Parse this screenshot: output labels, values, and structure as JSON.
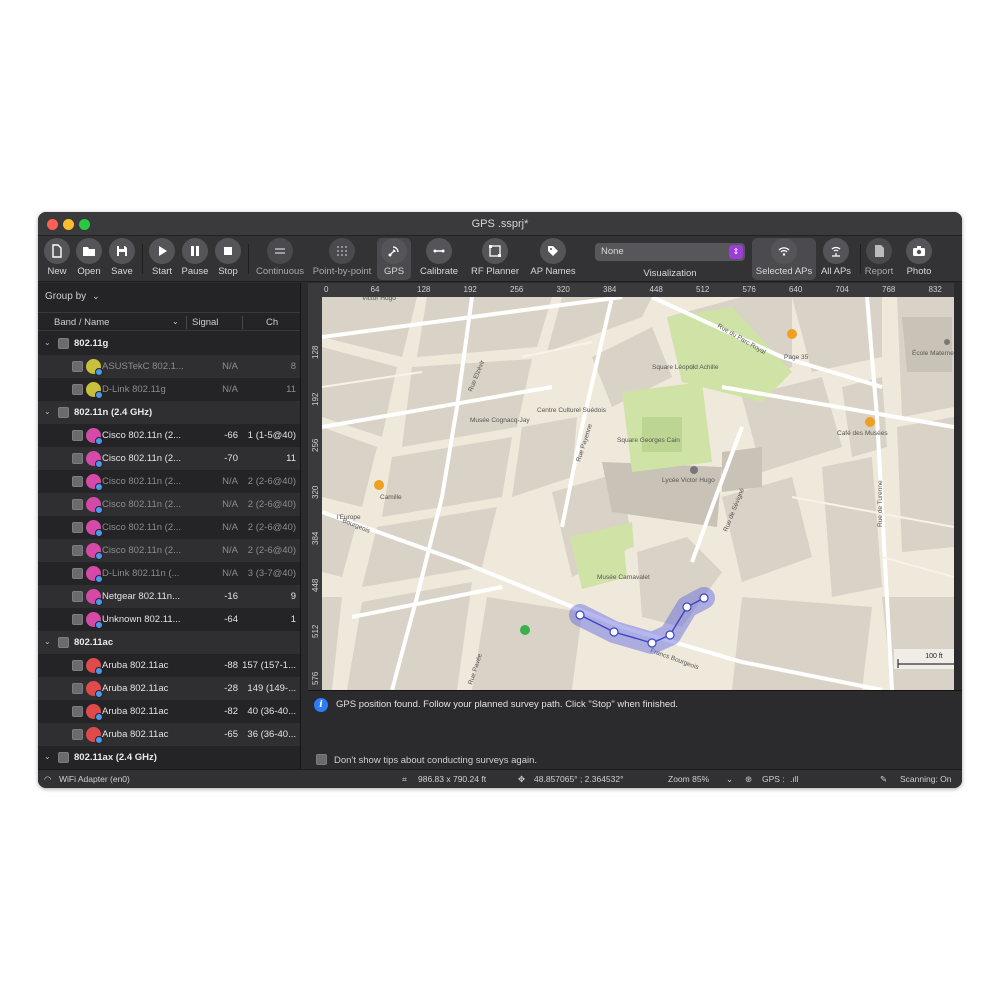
{
  "window": {
    "title": "GPS .ssprj*"
  },
  "toolbar": {
    "new": "New",
    "open": "Open",
    "save": "Save",
    "start": "Start",
    "pause": "Pause",
    "stop": "Stop",
    "continuous": "Continuous",
    "point_by_point": "Point-by-point",
    "gps": "GPS",
    "calibrate": "Calibrate",
    "rf_planner": "RF Planner",
    "ap_names": "AP Names",
    "visualization_value": "None",
    "visualization_label": "Visualization",
    "selected_aps": "Selected APs",
    "all_aps": "All APs",
    "report": "Report",
    "photo": "Photo"
  },
  "sidebar": {
    "group_by": "Group by",
    "columns": {
      "band_name": "Band / Name",
      "signal": "Signal",
      "ch": "Ch"
    },
    "rows": [
      {
        "type": "group",
        "band": "802.11g"
      },
      {
        "type": "ap",
        "name": "ASUSTekC 802.1...",
        "signal": "N/A",
        "ch": "8",
        "muted": true,
        "color": "#c8c03a"
      },
      {
        "type": "ap",
        "name": "D-Link 802.11g",
        "signal": "N/A",
        "ch": "11",
        "muted": true,
        "color": "#c8c03a"
      },
      {
        "type": "group",
        "band": "802.11n (2.4 GHz)"
      },
      {
        "type": "ap",
        "name": "Cisco 802.11n (2...",
        "signal": "-66",
        "ch": "1 (1-5@40)",
        "muted": false,
        "color": "#d54aa8"
      },
      {
        "type": "ap",
        "name": "Cisco 802.11n (2...",
        "signal": "-70",
        "ch": "11",
        "muted": false,
        "color": "#d54aa8"
      },
      {
        "type": "ap",
        "name": "Cisco 802.11n (2...",
        "signal": "N/A",
        "ch": "2 (2-6@40)",
        "muted": true,
        "color": "#d54aa8"
      },
      {
        "type": "ap",
        "name": "Cisco 802.11n (2...",
        "signal": "N/A",
        "ch": "2 (2-6@40)",
        "muted": true,
        "color": "#d54aa8"
      },
      {
        "type": "ap",
        "name": "Cisco 802.11n (2...",
        "signal": "N/A",
        "ch": "2 (2-6@40)",
        "muted": true,
        "color": "#d54aa8"
      },
      {
        "type": "ap",
        "name": "Cisco 802.11n (2...",
        "signal": "N/A",
        "ch": "2 (2-6@40)",
        "muted": true,
        "color": "#d54aa8"
      },
      {
        "type": "ap",
        "name": "D-Link 802.11n (...",
        "signal": "N/A",
        "ch": "3 (3-7@40)",
        "muted": true,
        "color": "#d54aa8"
      },
      {
        "type": "ap",
        "name": "Netgear 802.11n...",
        "signal": "-16",
        "ch": "9",
        "muted": false,
        "color": "#d54aa8"
      },
      {
        "type": "ap",
        "name": "Unknown 802.11...",
        "signal": "-64",
        "ch": "1",
        "muted": false,
        "color": "#d54aa8"
      },
      {
        "type": "group",
        "band": "802.11ac"
      },
      {
        "type": "ap",
        "name": "Aruba 802.11ac",
        "signal": "-88",
        "ch": "157 (157-1...",
        "muted": false,
        "color": "#e04a4a"
      },
      {
        "type": "ap",
        "name": "Aruba 802.11ac",
        "signal": "-28",
        "ch": "149 (149-...",
        "muted": false,
        "color": "#e04a4a"
      },
      {
        "type": "ap",
        "name": "Aruba 802.11ac",
        "signal": "-82",
        "ch": "40 (36-40...",
        "muted": false,
        "color": "#e04a4a"
      },
      {
        "type": "ap",
        "name": "Aruba 802.11ac",
        "signal": "-65",
        "ch": "36 (36-40...",
        "muted": false,
        "color": "#e04a4a"
      },
      {
        "type": "group",
        "band": "802.11ax (2.4 GHz)"
      }
    ]
  },
  "ruler": {
    "top_ticks": [
      "0",
      "64",
      "128",
      "192",
      "256",
      "320",
      "384",
      "448",
      "512",
      "576",
      "640",
      "704",
      "768",
      "832"
    ],
    "left_ticks": [
      "128",
      "192",
      "256",
      "320",
      "384",
      "448",
      "512",
      "576"
    ]
  },
  "map": {
    "labels": [
      "Rue du Parc Royal",
      "Page 35",
      "Square Léopold Achille",
      "École Maternelle",
      "Rue Elzévir",
      "Musée Cognacq-Jay",
      "Centre Culturel Suédois",
      "Rue Payenne",
      "Square Georges Cain",
      "Café des Musées",
      "Lycée Victor Hugo",
      "Rue de Sévigné",
      "Rue de Turenne",
      "Bourgeois",
      "Camille",
      "l'Europe",
      "Musée Carnavalet",
      "Rue Pavée",
      "Francs Bourgeois",
      "Victor Hugo"
    ],
    "scale_label": "100 ft"
  },
  "tip": {
    "text": "GPS position found. Follow your planned survey path. Click \"Stop\" when finished.",
    "checkbox_label": "Don't show tips about conducting surveys again."
  },
  "status": {
    "adapter": "WiFi Adapter (en0)",
    "dimensions": "986.83 x 790.24 ft",
    "coordinates": "48.857065° ; 2.364532°",
    "zoom": "Zoom 85%",
    "gps": "GPS :",
    "scanning": "Scanning: On"
  },
  "colors": {
    "accent": "#9b3dd9",
    "path": "#5b62e0",
    "info": "#2e7cf6"
  }
}
